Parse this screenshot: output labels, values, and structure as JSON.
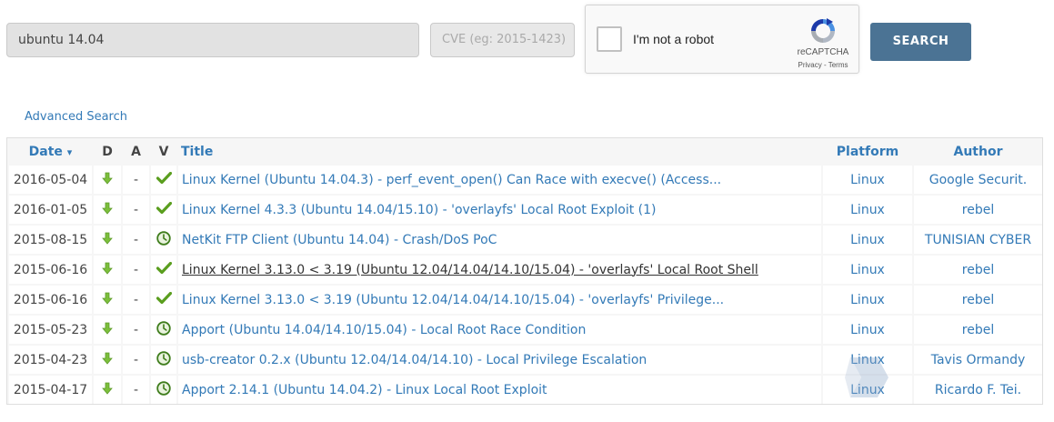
{
  "search": {
    "value": "ubuntu 14.04"
  },
  "cve": {
    "placeholder": "CVE (eg: 2015-1423)"
  },
  "captcha": {
    "label": "I'm not a robot",
    "brand": "reCAPTCHA",
    "terms": "Privacy - Terms"
  },
  "search_button": {
    "label": "SEARCH"
  },
  "advanced_search": "Advanced Search",
  "table": {
    "headers": {
      "date": "Date",
      "sort_indicator": "▾",
      "d": "D",
      "a": "A",
      "v": "V",
      "title": "Title",
      "platform": "Platform",
      "author": "Author"
    },
    "rows": [
      {
        "date": "2016-05-04",
        "a": "-",
        "verified": "check",
        "title": "Linux Kernel (Ubuntu 14.04.3) - perf_event_open() Can Race with execve() (Access...",
        "platform": "Linux",
        "author": "Google Securit."
      },
      {
        "date": "2016-01-05",
        "a": "-",
        "verified": "check",
        "title": "Linux Kernel 4.3.3 (Ubuntu 14.04/15.10) - 'overlayfs' Local Root Exploit (1)",
        "platform": "Linux",
        "author": "rebel"
      },
      {
        "date": "2015-08-15",
        "a": "-",
        "verified": "clock",
        "title": "NetKit FTP Client (Ubuntu 14.04) - Crash/DoS PoC",
        "platform": "Linux",
        "author": "TUNISIAN CYBER"
      },
      {
        "date": "2015-06-16",
        "a": "-",
        "verified": "check",
        "title": "Linux Kernel 3.13.0 < 3.19 (Ubuntu 12.04/14.04/14.10/15.04) - 'overlayfs' Local Root Shell",
        "platform": "Linux",
        "author": "rebel"
      },
      {
        "date": "2015-06-16",
        "a": "-",
        "verified": "check",
        "title": "Linux Kernel 3.13.0 < 3.19 (Ubuntu 12.04/14.04/14.10/15.04) - 'overlayfs' Privilege...",
        "platform": "Linux",
        "author": "rebel"
      },
      {
        "date": "2015-05-23",
        "a": "-",
        "verified": "clock",
        "title": "Apport (Ubuntu 14.04/14.10/15.04) - Local Root Race Condition",
        "platform": "Linux",
        "author": "rebel"
      },
      {
        "date": "2015-04-23",
        "a": "-",
        "verified": "clock",
        "title": "usb-creator 0.2.x (Ubuntu 12.04/14.04/14.10) - Local Privilege Escalation",
        "platform": "Linux",
        "author": "Tavis Ormandy"
      },
      {
        "date": "2015-04-17",
        "a": "-",
        "verified": "clock",
        "title": "Apport 2.14.1 (Ubuntu 14.04.2) - Linux Local Root Exploit",
        "platform": "Linux",
        "author": "Ricardo F. Tei."
      }
    ]
  },
  "colors": {
    "link": "#337ab7",
    "button": "#4b7394",
    "download": "#7cbf3b",
    "verified": "#5a9e1e",
    "pending": "#3f7d1c"
  },
  "icons": {
    "download": "download-arrow-icon",
    "verified": "checkmark-icon",
    "pending": "clock-icon",
    "sort": "sort-caret-icon"
  }
}
